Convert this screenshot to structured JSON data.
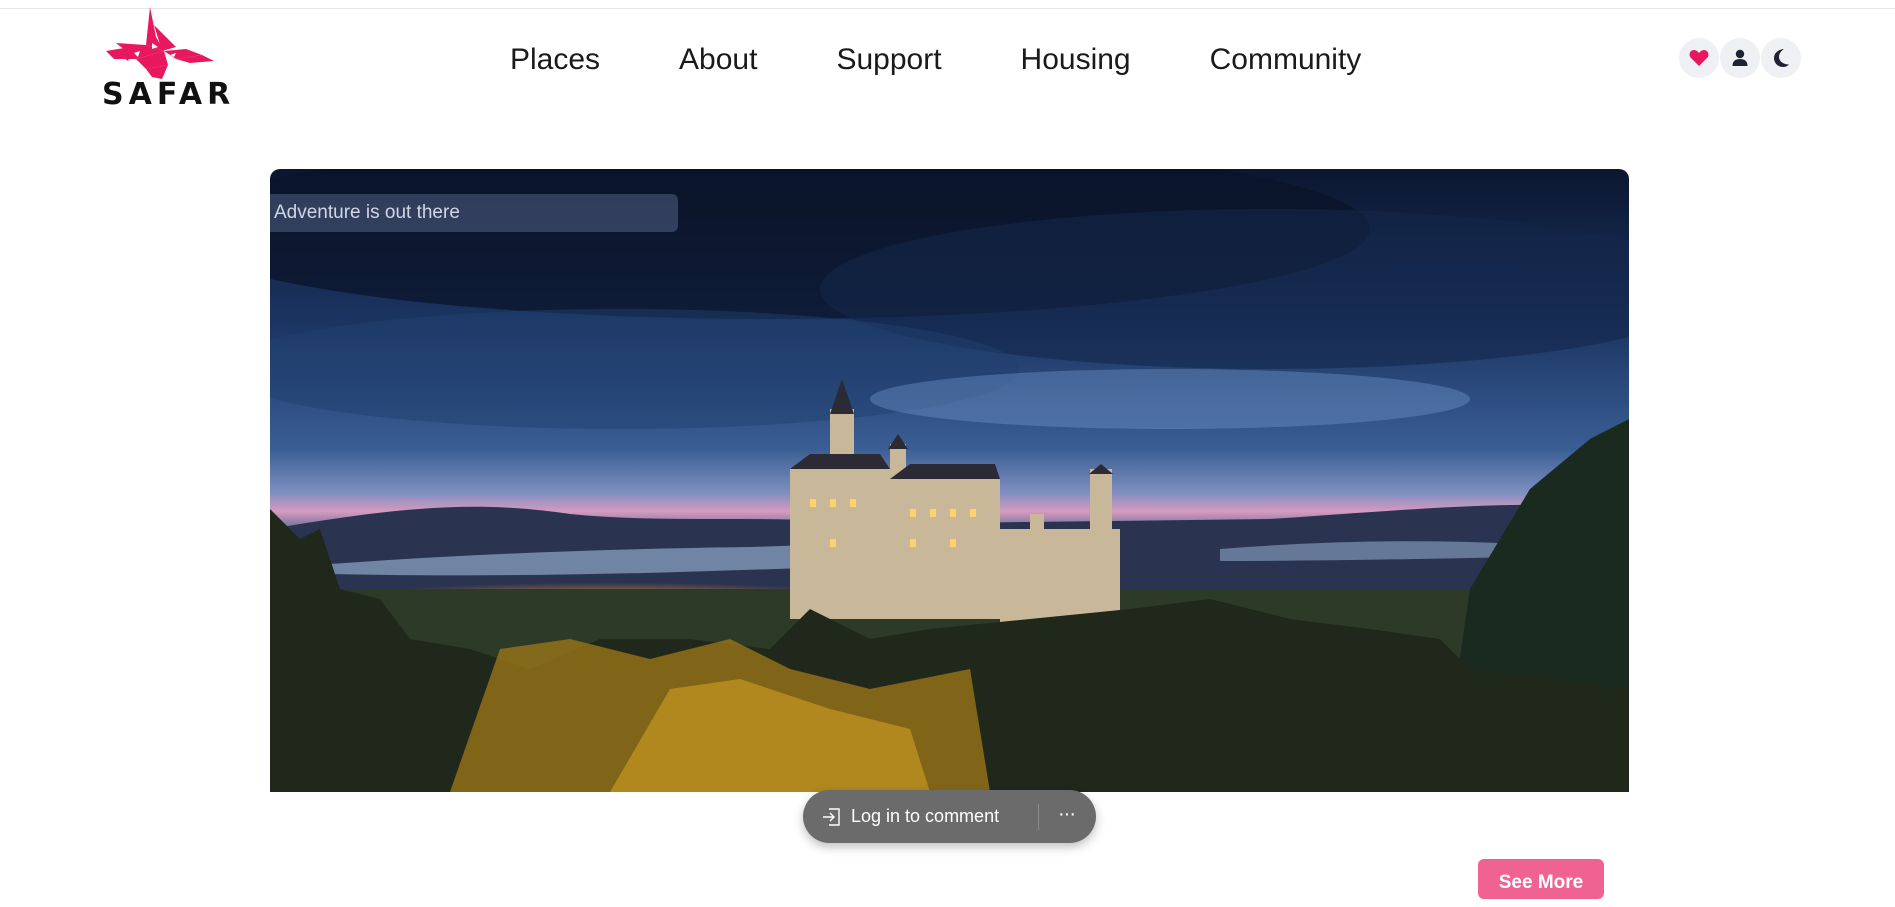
{
  "brand": {
    "name": "SAFAR",
    "accent": "#e8185f"
  },
  "nav": {
    "items": [
      {
        "label": "Places"
      },
      {
        "label": "About"
      },
      {
        "label": "Support"
      },
      {
        "label": "Housing"
      },
      {
        "label": "Community"
      }
    ]
  },
  "header_icons": [
    "heart-icon",
    "user-icon",
    "moon-icon"
  ],
  "hero": {
    "search_placeholder": "Adventure is out there"
  },
  "comment_bar": {
    "label": "Log in to comment",
    "more": "···"
  },
  "cta": {
    "label": "See More",
    "color": "#f06292"
  }
}
